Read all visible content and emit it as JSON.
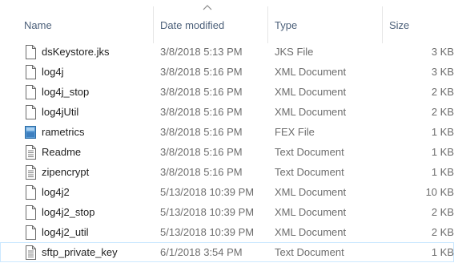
{
  "columns": {
    "name": "Name",
    "date_modified": "Date modified",
    "type": "Type",
    "size": "Size"
  },
  "files": [
    {
      "name": "dsKeystore.jks",
      "date": "3/8/2018 5:13 PM",
      "type": "JKS File",
      "size": "3 KB",
      "icon": "blank-file-icon"
    },
    {
      "name": "log4j",
      "date": "3/8/2018 5:16 PM",
      "type": "XML Document",
      "size": "3 KB",
      "icon": "blank-file-icon"
    },
    {
      "name": "log4j_stop",
      "date": "3/8/2018 5:16 PM",
      "type": "XML Document",
      "size": "2 KB",
      "icon": "blank-file-icon"
    },
    {
      "name": "log4jUtil",
      "date": "3/8/2018 5:16 PM",
      "type": "XML Document",
      "size": "2 KB",
      "icon": "blank-file-icon"
    },
    {
      "name": "rametrics",
      "date": "3/8/2018 5:16 PM",
      "type": "FEX File",
      "size": "1 KB",
      "icon": "fex-file-icon"
    },
    {
      "name": "Readme",
      "date": "3/8/2018 5:16 PM",
      "type": "Text Document",
      "size": "1 KB",
      "icon": "text-file-icon"
    },
    {
      "name": "zipencrypt",
      "date": "3/8/2018 5:16 PM",
      "type": "Text Document",
      "size": "1 KB",
      "icon": "text-file-icon"
    },
    {
      "name": "log4j2",
      "date": "5/13/2018 10:39 PM",
      "type": "XML Document",
      "size": "10 KB",
      "icon": "blank-file-icon"
    },
    {
      "name": "log4j2_stop",
      "date": "5/13/2018 10:39 PM",
      "type": "XML Document",
      "size": "2 KB",
      "icon": "blank-file-icon"
    },
    {
      "name": "log4j2_util",
      "date": "5/13/2018 10:39 PM",
      "type": "XML Document",
      "size": "2 KB",
      "icon": "blank-file-icon"
    },
    {
      "name": "sftp_private_key",
      "date": "6/1/2018 3:54 PM",
      "type": "Text Document",
      "size": "1 KB",
      "icon": "text-file-icon"
    }
  ]
}
